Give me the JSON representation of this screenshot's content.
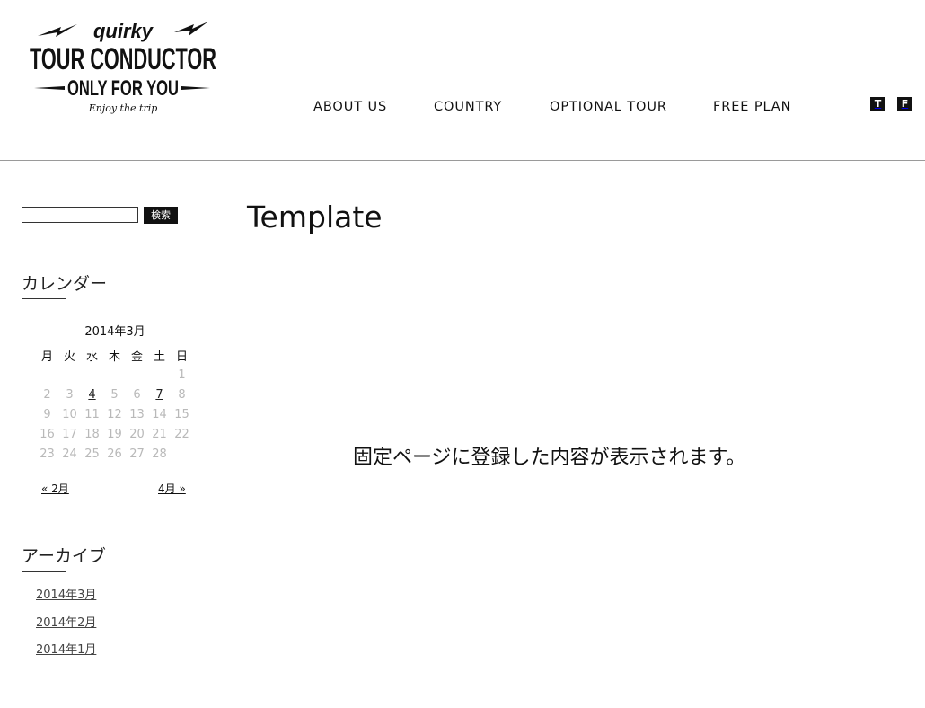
{
  "header": {
    "logo": {
      "line1": "quirky",
      "line2": "TOUR CONDUCTOR",
      "line3": "ONLY FOR YOU",
      "line4": "Enjoy the trip"
    },
    "nav": [
      {
        "label": "ABOUT US"
      },
      {
        "label": "COUNTRY"
      },
      {
        "label": "OPTIONAL TOUR"
      },
      {
        "label": "FREE PLAN"
      }
    ],
    "social": {
      "twitter_glyph": "T",
      "facebook_glyph": "F"
    }
  },
  "sidebar": {
    "search": {
      "value": "",
      "button_label": "検索"
    },
    "calendar": {
      "title": "カレンダー",
      "caption": "2014年3月",
      "weekdays": [
        "月",
        "火",
        "水",
        "木",
        "金",
        "土",
        "日"
      ],
      "weeks": [
        [
          "",
          "",
          "",
          "",
          "",
          "",
          "1"
        ],
        [
          "2",
          "3",
          "4",
          "5",
          "6",
          "7",
          "8"
        ],
        [
          "9",
          "10",
          "11",
          "12",
          "13",
          "14",
          "15"
        ],
        [
          "16",
          "17",
          "18",
          "19",
          "20",
          "21",
          "22"
        ],
        [
          "23",
          "24",
          "25",
          "26",
          "27",
          "28",
          ""
        ]
      ],
      "linked_days": [
        "4",
        "7"
      ],
      "prev_label": "« 2月",
      "next_label": "4月 »"
    },
    "archive": {
      "title": "アーカイブ",
      "items": [
        "2014年3月",
        "2014年2月",
        "2014年1月"
      ]
    }
  },
  "main": {
    "title": "Template",
    "content": "固定ページに登録した内容が表示されます。"
  },
  "colors": {
    "text": "#111111",
    "muted_day": "#b9b9b9",
    "divider": "#9a9a9a"
  }
}
